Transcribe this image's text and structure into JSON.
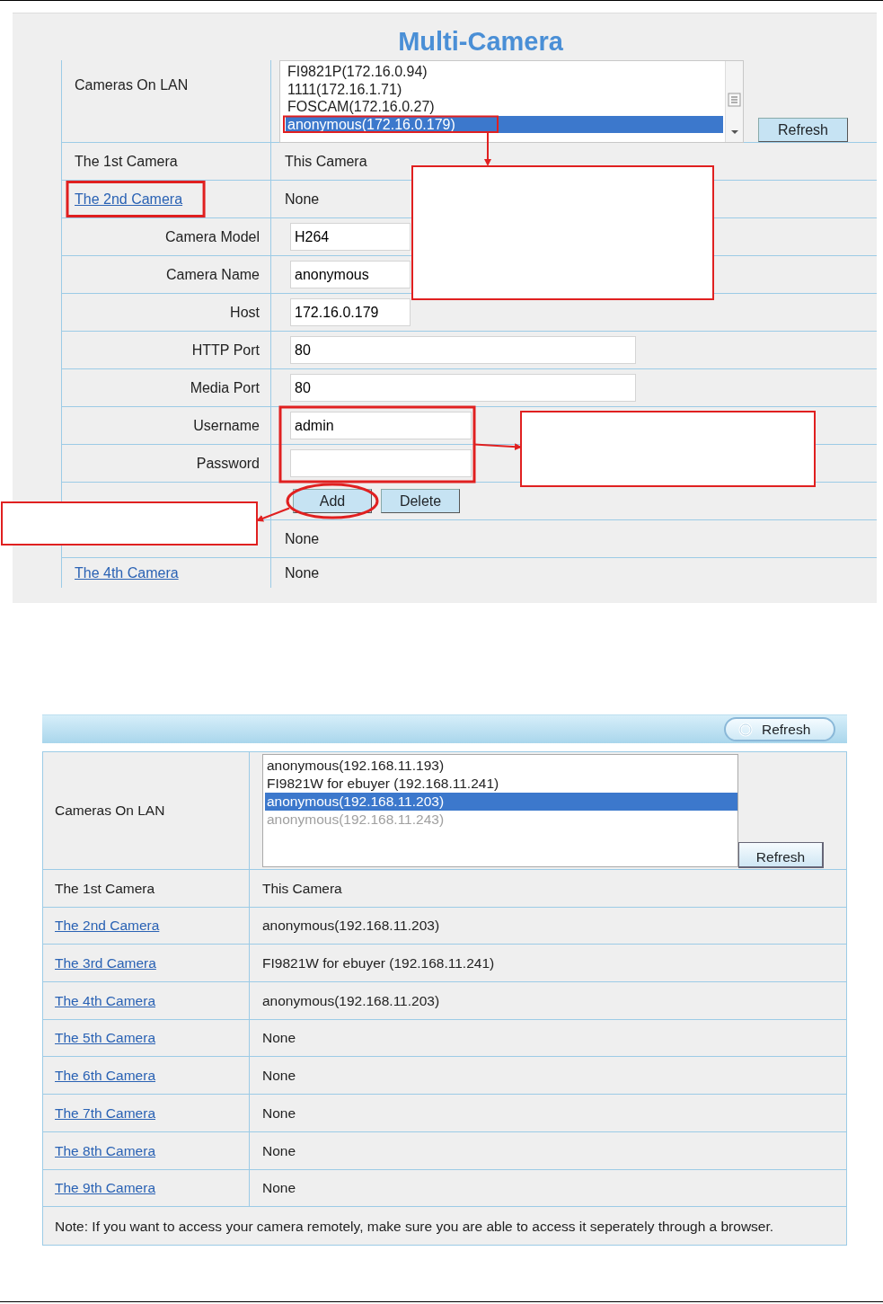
{
  "first_screen": {
    "title": "Multi-Camera",
    "lan_label": "Cameras On LAN",
    "lan_list": [
      {
        "text": "FI9821P(172.16.0.94)",
        "selected": false
      },
      {
        "text": "1111(172.16.1.71)",
        "selected": false
      },
      {
        "text": "FOSCAM(172.16.0.27)",
        "selected": false
      },
      {
        "text": "anonymous(172.16.0.179)",
        "selected": true
      }
    ],
    "refresh": "Refresh",
    "rows": [
      {
        "kind": "text",
        "label": "The 1st Camera",
        "value": "This Camera"
      },
      {
        "kind": "link",
        "label": "The 2nd Camera",
        "value": "None"
      },
      {
        "kind": "field",
        "label": "Camera Model",
        "value": "H264"
      },
      {
        "kind": "field",
        "label": "Camera Name",
        "value": "anonymous"
      },
      {
        "kind": "field",
        "label": "Host",
        "value": "172.16.0.179"
      },
      {
        "kind": "field",
        "label": "HTTP Port",
        "value": "80"
      },
      {
        "kind": "field",
        "label": "Media Port",
        "value": "80"
      },
      {
        "kind": "field",
        "label": "Username",
        "value": "admin"
      },
      {
        "kind": "password",
        "label": "Password"
      },
      {
        "kind": "buttons",
        "buttons": [
          "Add",
          "Delete"
        ]
      },
      {
        "kind": "link",
        "value": "None"
      },
      {
        "kind": "link",
        "label": "The 4th Camera",
        "value": "None"
      }
    ]
  },
  "second_screen": {
    "header_button": "Refresh",
    "lan_label": "Cameras On LAN",
    "lan_list": [
      {
        "text": "anonymous(192.168.11.193)",
        "selected": false,
        "disabled": false
      },
      {
        "text": "FI9821W for ebuyer (192.168.11.241)",
        "selected": false,
        "disabled": false
      },
      {
        "text": "anonymous(192.168.11.203)",
        "selected": true,
        "disabled": false
      },
      {
        "text": "anonymous(192.168.11.243)",
        "selected": false,
        "disabled": true
      }
    ],
    "refresh": "Refresh",
    "rows": [
      {
        "kind": "text",
        "label": "The 1st Camera",
        "value": "This Camera"
      },
      {
        "kind": "link",
        "label": "The 2nd Camera",
        "value": "anonymous(192.168.11.203)"
      },
      {
        "kind": "link",
        "label": "The 3rd Camera",
        "value": "FI9821W for ebuyer (192.168.11.241)"
      },
      {
        "kind": "link",
        "label": "The 4th Camera",
        "value": "anonymous(192.168.11.203)"
      },
      {
        "kind": "link",
        "label": "The 5th Camera",
        "value": "None"
      },
      {
        "kind": "link",
        "label": "The 6th Camera",
        "value": "None"
      },
      {
        "kind": "link",
        "label": "The 7th Camera",
        "value": "None"
      },
      {
        "kind": "link",
        "label": "The 8th Camera",
        "value": "None"
      },
      {
        "kind": "link",
        "label": "The 9th Camera",
        "value": "None"
      }
    ],
    "note": "Note: If you want to access your camera remotely, make sure you are able to access it seperately through a browser."
  }
}
